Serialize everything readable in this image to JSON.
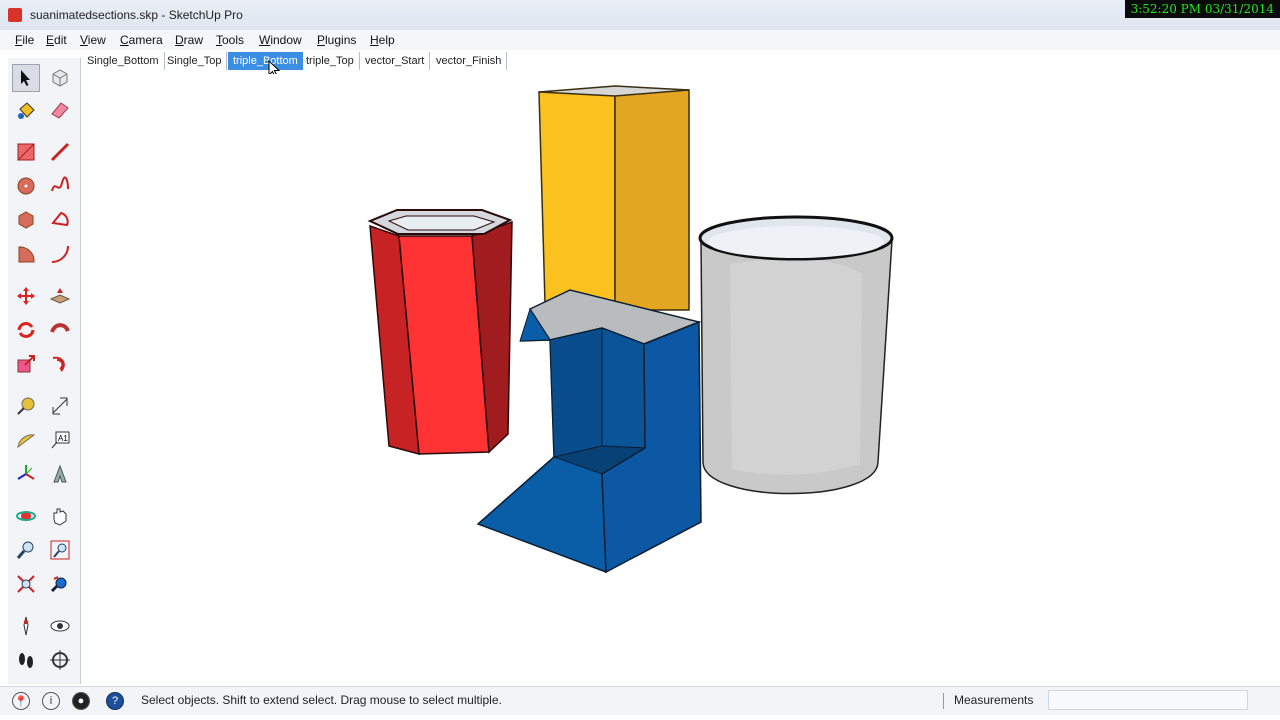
{
  "window": {
    "title": "suanimatedsections.skp - SketchUp Pro"
  },
  "clock": "3:52:20 PM 03/31/2014",
  "menu": [
    {
      "label": "File"
    },
    {
      "label": "Edit"
    },
    {
      "label": "View"
    },
    {
      "label": "Camera"
    },
    {
      "label": "Draw"
    },
    {
      "label": "Tools"
    },
    {
      "label": "Window"
    },
    {
      "label": "Plugins"
    },
    {
      "label": "Help"
    }
  ],
  "scenes": [
    {
      "label": "Single_Bottom"
    },
    {
      "label": "Single_Top"
    },
    {
      "label": "triple_Bottom",
      "active": true
    },
    {
      "label": "triple_Top"
    },
    {
      "label": "vector_Start"
    },
    {
      "label": "vector_Finish"
    }
  ],
  "toolbar": {
    "tools": [
      "select-icon",
      "make-component-icon",
      "paint-bucket-icon",
      "eraser-icon",
      "rectangle-icon",
      "line-icon",
      "circle-icon",
      "freehand-icon",
      "polygon-icon",
      "pie-icon",
      "arc-icon",
      "two-point-arc-icon",
      "move-icon",
      "push-pull-icon",
      "rotate-icon",
      "follow-me-icon",
      "scale-icon",
      "offset-icon",
      "tape-measure-icon",
      "dimension-icon",
      "protractor-icon",
      "text-icon",
      "axes-icon",
      "3d-text-icon",
      "orbit-icon",
      "pan-icon",
      "zoom-icon",
      "zoom-window-icon",
      "zoom-extents-icon",
      "previous-view-icon",
      "position-camera-icon",
      "look-around-icon",
      "walk-icon",
      "section-plane-icon"
    ]
  },
  "status": {
    "message": "Select objects. Shift to extend select. Drag mouse to select multiple.",
    "measurements_label": "Measurements",
    "measurements_value": ""
  },
  "colors": {
    "red": "#f3302f",
    "yellow": "#f9bd1f",
    "blue": "#0a5bb2",
    "gray": "#cfd0d2",
    "accent": "#3b8fe3"
  }
}
